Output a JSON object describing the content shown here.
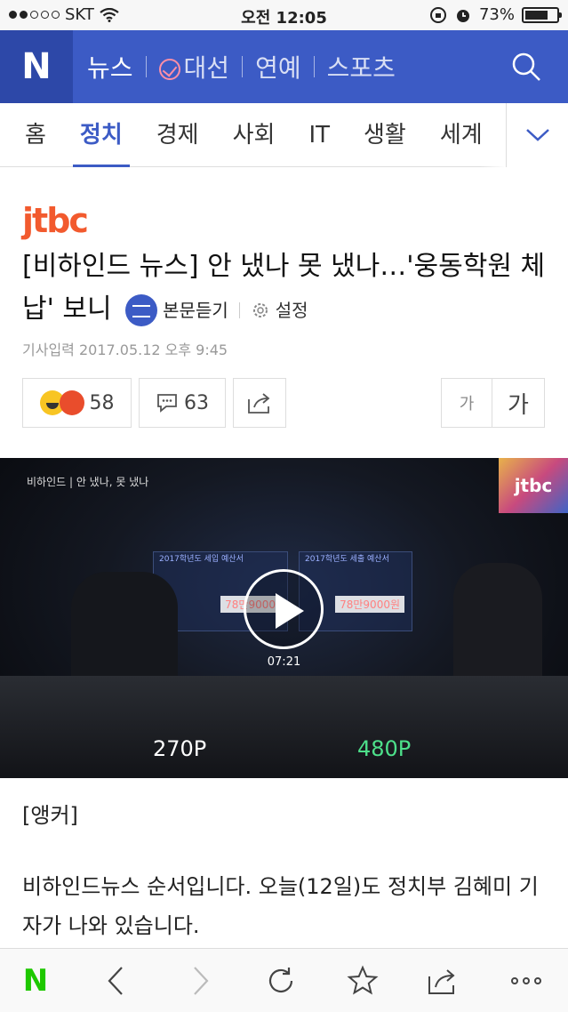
{
  "status_bar": {
    "carrier": "SKT",
    "time": "오전 12:05",
    "battery": "73%",
    "battery_level": 0.73
  },
  "header": {
    "logo": "N",
    "menu": [
      {
        "label": "뉴스"
      },
      {
        "label": "대선",
        "icon": "vote-icon"
      },
      {
        "label": "연예"
      },
      {
        "label": "스포츠"
      }
    ],
    "search_icon": "search-icon"
  },
  "tabs": [
    "홈",
    "정치",
    "경제",
    "사회",
    "IT",
    "생활",
    "세계"
  ],
  "active_tab": "정치",
  "article": {
    "source_logo": "jtbc",
    "title": "[비하인드 뉴스] 안 냈나 못 냈나…'웅동학원 체납' 보니",
    "listen_label": "본문듣기",
    "settings_label": "설정",
    "date": "기사입력  2017.05.12 오후 9:45",
    "reaction_count": "58",
    "comment_count": "63",
    "font_small": "가",
    "font_large": "가"
  },
  "video": {
    "overlay_title": "비하인드 | 안 냈나, 못 냈나",
    "logo": "jtbc",
    "screen_left_title": "2017학년도 세입 예산서",
    "screen_left_value": "78만9000",
    "screen_right_title": "2017학년도 세출 예산서",
    "screen_right_value": "78만9000원",
    "duration": "07:21",
    "quality_low": "270P",
    "quality_high": "480P"
  },
  "body": [
    "[앵커]",
    "비하인드뉴스 순서입니다. 오늘(12일)도 정치부 김혜미 기자가 나와 있습니다."
  ],
  "toolbar": {
    "home": "N"
  },
  "colors": {
    "brand_blue": "#3c5bc5",
    "naver_green": "#1ec800",
    "hd_green": "#4de08a"
  }
}
